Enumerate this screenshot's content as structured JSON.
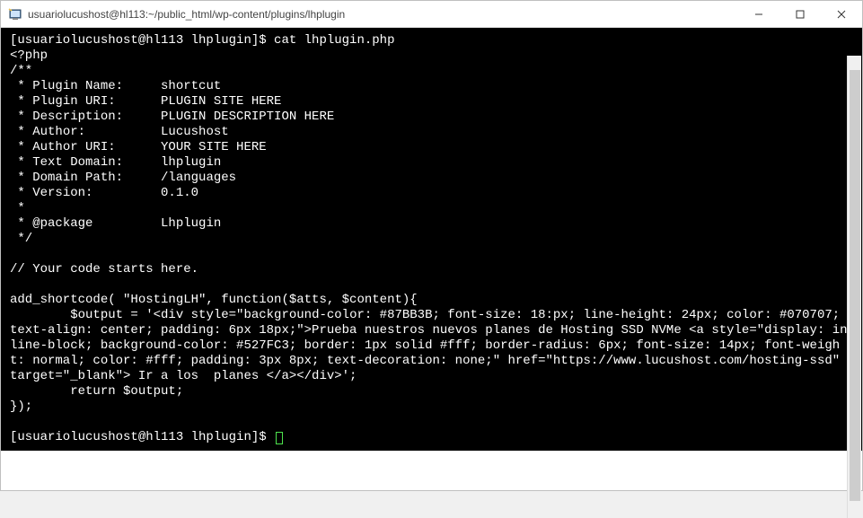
{
  "window": {
    "title": "usuariolucushost@hl113:~/public_html/wp-content/plugins/lhplugin"
  },
  "terminal": {
    "prompt1": "[usuariolucushost@hl113 lhplugin]$ ",
    "command1": "cat lhplugin.php",
    "lines": [
      "<?php",
      "/**",
      " * Plugin Name:     shortcut",
      " * Plugin URI:      PLUGIN SITE HERE",
      " * Description:     PLUGIN DESCRIPTION HERE",
      " * Author:          Lucushost",
      " * Author URI:      YOUR SITE HERE",
      " * Text Domain:     lhplugin",
      " * Domain Path:     /languages",
      " * Version:         0.1.0",
      " *",
      " * @package         Lhplugin",
      " */",
      "",
      "// Your code starts here.",
      "",
      "add_shortcode( \"HostingLH\", function($atts, $content){",
      "        $output = '<div style=\"background-color: #87BB3B; font-size: 18:px; line-height: 24px; color: #070707; text-align: center; padding: 6px 18px;\">Prueba nuestros nuevos planes de Hosting SSD NVMe <a style=\"display: inline-block; background-color: #527FC3; border: 1px solid #fff; border-radius: 6px; font-size: 14px; font-weight: normal; color: #fff; padding: 3px 8px; text-decoration: none;\" href=\"https://www.lucushost.com/hosting-ssd\" target=\"_blank\"> Ir a los  planes </a></div>';",
      "        return $output;",
      "});",
      ""
    ],
    "prompt2": "[usuariolucushost@hl113 lhplugin]$ "
  }
}
